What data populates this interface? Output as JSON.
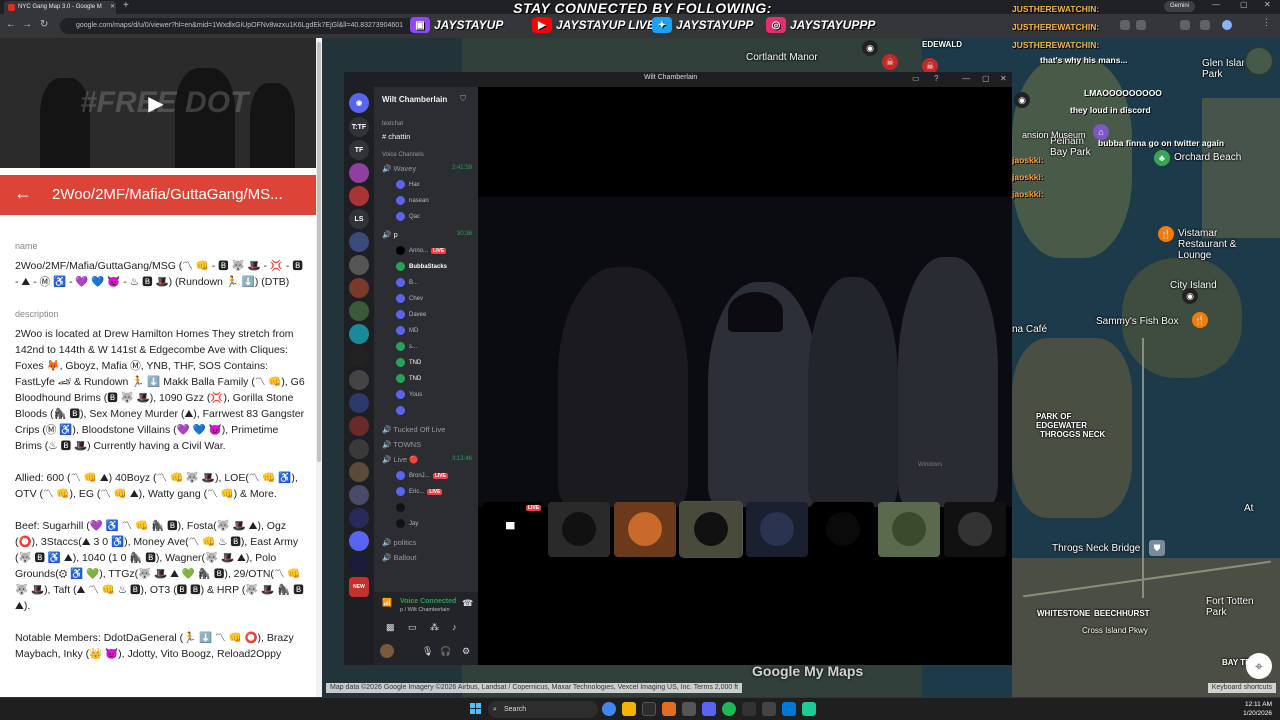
{
  "browser": {
    "tab_title": "NYC Gang Map 3.0 - Google M",
    "url": "google.com/maps/d/u/0/viewer?hl=en&mid=1WxdlxGiUpOFNv8wzxu1K6LgdEk7EjGl&ll=40.83273904601",
    "gemini_label": "Gemini"
  },
  "overlay": {
    "banner": "STAY CONNECTED BY FOLLOWING:",
    "socials": [
      {
        "platform": "twitch",
        "handle": "JAYSTAYUP",
        "color": "#9146ff"
      },
      {
        "platform": "youtube",
        "handle": "JAYSTAYUP LIVE",
        "color": "#ff0000"
      },
      {
        "platform": "twitter",
        "handle": "JAYSTAYUPP",
        "color": "#1da1f2"
      },
      {
        "platform": "instagram",
        "handle": "JAYSTAYUPPP",
        "color": "#e1306c"
      }
    ]
  },
  "left_panel": {
    "video_watermark": "#FREE DOT",
    "feature_title": "2Woo/2MF/Mafia/GuttaGang/MS...",
    "name_label": "name",
    "name_value": "2Woo/2MF/Mafia/GuttaGang/MSG (〽 👊 - 🅱 🐺 🎩 - 💢 - 🅱 - ⛰ - Ⓜ ♿ - 💜 💙 😈 - ♨ 🅱 🎩) (Rundown 🏃 ⬇️) (DTB)",
    "description_label": "description",
    "description_paragraphs": [
      "2Woo is located at Drew Hamilton Homes They stretch from 142nd to 144th & W 141st & Edgecombe Ave with Cliques: Foxes 🦊, Gboyz, Mafia Ⓜ, YNB, THF, SOS Contains: FastLyfe 🏎 & Rundown 🏃 ⬇️ Makk Balla Family (〽 👊), G6 Bloodhound Brims (🅱 🐺 🎩), 1090 Gzz (💢), Gorilla Stone Bloods (🦍 🅱), Sex Money Murder (⛰), Farrwest 83 Gangster Crips (Ⓜ ♿), Bloodstone Villains (💜 💙 😈), Primetime Brims (♨ 🅱 🎩) Currently having a Civil War.",
      "Allied: 600 (〽 👊 ⛰) 40Boyz (〽 👊 🐺 🎩), LOE(〽 👊 ♿), OTV (〽 👊), EG (〽 👊 ⛰), Watty gang (〽 👊) & More.",
      "Beef: Sugarhill (💜 ♿ 〽 👊 🦍 🅱), Fosta(🐺 🎩 ⛰), Ogz (⭕), 3Staccs(⛰ 3 0 ♿), Money Ave(〽 👊 ♨ 🅱), East Army (🐺 🅱 ♿ ⛰), 1040 (1 0 🦍 🅱), Wagner(🐺 🎩 ⛰), Polo Grounds(⚙ ♿ 💚), TTGz(🐺 🎩 ⛰ 💚 🦍 🅱), 29/OTN(〽 👊 🐺 🎩), Taft (⛰ 〽 👊 ♨ 🅱), OT3 (🅱 🅱) & HRP (🐺 🎩 🦍 🅱 ⛰).",
      "Notable Members: DdotDaGeneral (🏃 ⬇️ 〽 👊 ⭕), Brazy Maybach, Inky (👑 😈), Jdotty, Vito Boogz, Reload2Oppy"
    ]
  },
  "map": {
    "labels": [
      {
        "text": "Cortlandt Manor",
        "kind": "place"
      },
      {
        "text": "EDEWALD",
        "kind": "small"
      },
      {
        "text": "Glen Island Park",
        "kind": "place"
      },
      {
        "text": "Orchard Beach",
        "kind": "place"
      },
      {
        "text": "Pelham Bay Park",
        "kind": "place"
      },
      {
        "text": "Vistamar Restaurant & Lounge",
        "kind": "place"
      },
      {
        "text": "City Island",
        "kind": "place"
      },
      {
        "text": "Sammy's Fish Box",
        "kind": "place"
      },
      {
        "text": "na Café",
        "kind": "place"
      },
      {
        "text": "PARK OF EDGEWATER",
        "kind": "small"
      },
      {
        "text": "THROGGS NECK",
        "kind": "small"
      },
      {
        "text": "Throgs Neck Bridge",
        "kind": "place"
      },
      {
        "text": "At",
        "kind": "place"
      },
      {
        "text": "WHITESTONE",
        "kind": "small"
      },
      {
        "text": "BEECHHURST",
        "kind": "small"
      },
      {
        "text": "Fort Totten Park",
        "kind": "place"
      },
      {
        "text": "BAY TERRA",
        "kind": "small"
      },
      {
        "text": "Cross Island Pkwy",
        "kind": "place"
      },
      {
        "text": "ansion Museum",
        "kind": "place"
      }
    ],
    "credit": "Map data ©2026 Google Imagery ©2026 Airbus, Landsat / Copernicus, Maxar Technologies, Vexcel Imaging US, Inc.  Terms  2,000 ft",
    "keyboard_shortcuts": "Keyboard shortcuts",
    "logo": "Google My Maps"
  },
  "chat": [
    {
      "user": "JUSTHEREWATCHIN:",
      "msg": "",
      "color": "#ffb347"
    },
    {
      "user": "JUSTHEREWATCHIN:",
      "msg": "",
      "color": "#ffb347"
    },
    {
      "user": "JUSTHEREWATCHIN:",
      "msg": "",
      "color": "#ffb347"
    },
    {
      "user": "",
      "msg": "that's why his mans...",
      "color": "#ffffff"
    },
    {
      "user": "",
      "msg": "LMAOOOOOOOOO",
      "color": "#ffffff"
    },
    {
      "user": "",
      "msg": "they loud in discord",
      "color": "#ffffff"
    },
    {
      "user": "",
      "msg": "bubba finna go on twitter again",
      "color": "#ffffff"
    },
    {
      "user": "jaoskki:",
      "msg": "",
      "color": "#ff9a3c"
    },
    {
      "user": "jaoskki:",
      "msg": "",
      "color": "#ff9a3c"
    },
    {
      "user": "jaoskki:",
      "msg": "",
      "color": "#ff9a3c"
    }
  ],
  "discord": {
    "window_title": "Wilt Chamberlain",
    "server_name": "Wilt Chamberlain",
    "guild_badges": [
      "T:TF",
      "TF",
      "LS",
      "NEW"
    ],
    "text_category": "textchat",
    "text_channel": "chattin",
    "voice_category": "Voice Channels",
    "voice_channels": [
      {
        "name": "Wavey",
        "timer": "2:41:59"
      },
      {
        "name": "p",
        "timer": "30:36"
      },
      {
        "name": "Tucked Off Live",
        "timer": ""
      },
      {
        "name": "TOWNS",
        "timer": ""
      },
      {
        "name": "Live 🔴",
        "timer": "3:13:46"
      },
      {
        "name": "politics",
        "timer": ""
      },
      {
        "name": "Ballout",
        "timer": ""
      }
    ],
    "wavey_users": [
      "Hax",
      "nasean",
      "Qac"
    ],
    "p_users": [
      "Anno...",
      "BubbaStacks",
      "B...",
      "Chev",
      "Davee",
      "MD",
      "s...",
      "TND",
      "TND",
      "Yous",
      ""
    ],
    "live_users": [
      "BronJ...",
      "Eric...",
      "",
      "Jay"
    ],
    "live_badge": "LIVE",
    "voice_status": "Voice Connected",
    "voice_channel_path": "p / Wilt Chamberlain",
    "tile_live": "LIVE",
    "stream_watermark": "Windows"
  },
  "taskbar": {
    "search": "Search",
    "time": "12:11 AM",
    "date": "1/20/2026"
  }
}
